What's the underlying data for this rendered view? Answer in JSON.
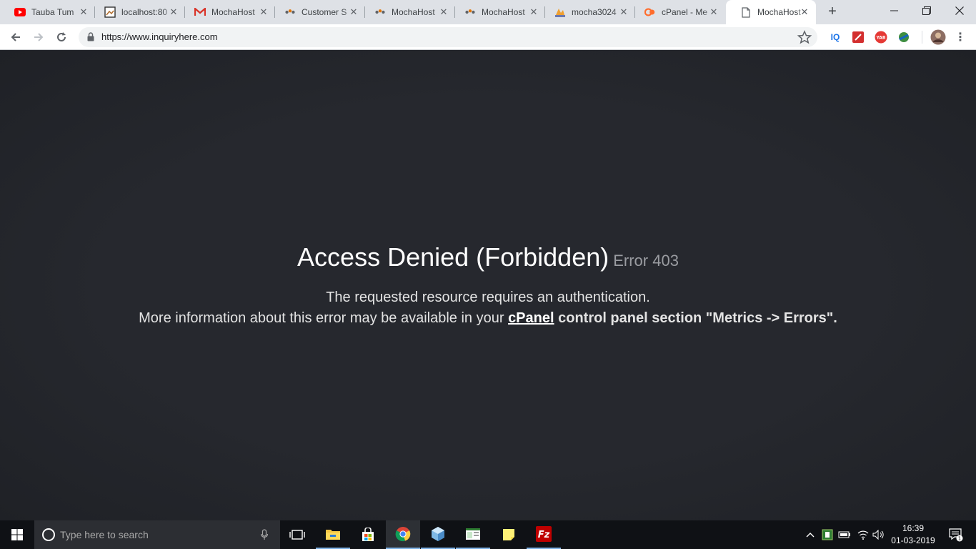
{
  "browser": {
    "tabs": [
      {
        "title": "Tauba Tum",
        "icon": "youtube-icon"
      },
      {
        "title": "localhost:80",
        "icon": "image-icon"
      },
      {
        "title": "MochaHost",
        "icon": "gmail-icon"
      },
      {
        "title": "Customer S",
        "icon": "mochahost-icon"
      },
      {
        "title": "MochaHost",
        "icon": "mochahost-icon"
      },
      {
        "title": "MochaHost",
        "icon": "mochahost-icon"
      },
      {
        "title": "mocha3024",
        "icon": "phpmyadmin-icon"
      },
      {
        "title": "cPanel - Me",
        "icon": "cpanel-icon"
      },
      {
        "title": "MochaHost",
        "icon": "page-icon",
        "active": true
      }
    ],
    "url": "https://www.inquiryhere.com",
    "extensions": [
      {
        "label": "IQ",
        "color": "#1a73e8"
      },
      {
        "label": "",
        "color": "#d32f2f"
      },
      {
        "label": "YAB",
        "color": "#e53935"
      },
      {
        "label": "",
        "color": "#3e8e41"
      }
    ]
  },
  "page": {
    "title": "Access Denied (Forbidden)",
    "code": "Error 403",
    "line1": "The requested resource requires an authentication.",
    "line2_prefix": "More information about this error may be available in your ",
    "line2_link": "cPanel",
    "line2_suffix": " control panel section \"Metrics -> Errors\"."
  },
  "taskbar": {
    "search_placeholder": "Type here to search",
    "time": "16:39",
    "date": "01-03-2019",
    "notifications_count": "1"
  }
}
